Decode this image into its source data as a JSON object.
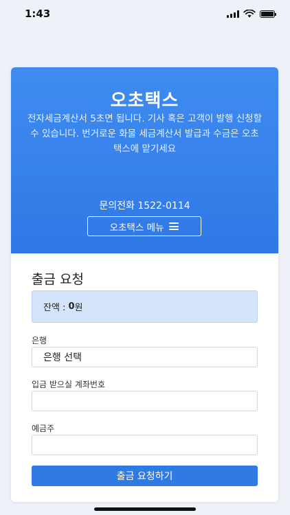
{
  "status_bar": {
    "time": "1:43"
  },
  "hero": {
    "brand": "오초택스",
    "description": "전자세금계산서 5초면 됩니다. 기사 혹은 고객이 발행 신청할 수 있습니다. 번거로운 화물 세금계산서 발급과 수금은 오초택스에 맡기세요",
    "phone": "문의전화 1522-0114",
    "menu_label": "오초택스 메뉴"
  },
  "form": {
    "title": "출금 요청",
    "balance_label": "잔액 :",
    "balance_value": "0",
    "balance_unit": "원",
    "bank_label": "은행",
    "bank_value": "은행 선택",
    "account_label": "입금 받으실 계좌번호",
    "account_value": "",
    "holder_label": "예금주",
    "holder_value": "",
    "submit_label": "출금 요청하기"
  },
  "colors": {
    "primary": "#2f7be3",
    "hero_top": "#3f8cf0",
    "balance_bg": "#d4e4fb",
    "page_bg": "#eef1f7"
  }
}
